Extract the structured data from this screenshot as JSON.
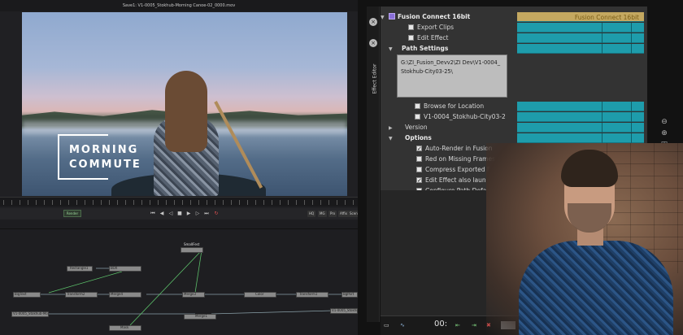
{
  "viewer": {
    "filename": "Save1: V1-0005_Stokhub-Morning Canoe-02_0000.mov",
    "title_line1": "MORNING",
    "title_line2": "COMMUTE"
  },
  "transport": {
    "render_label": "Render",
    "chips": [
      "HQ",
      "MG",
      "Prx",
      "Affix",
      "Scene"
    ]
  },
  "node_editor": {
    "nodes": [
      "SmallFest",
      "Rectangle1",
      "BOX",
      "BigText",
      "Transform2",
      "Merge4",
      "Merge3",
      "Color",
      "Transform1",
      "BgPort",
      "V1-0005_Stokhub-Mo...",
      "Merge1",
      "Mask",
      "V1-0005_Stokhub-Mo..."
    ]
  },
  "effect_editor": {
    "side_label": "Effect Editor",
    "header_title": "Fusion Connect 16bit",
    "header_keyframe_label": "Fusion Connect 16bit",
    "rows": {
      "export_clips": "Export Clips",
      "edit_effect": "Edit Effect",
      "path_settings": "Path Settings",
      "browse": "Browse for Location",
      "clip_name": "V1-0004_Stokhub-City03-2",
      "version": "Version",
      "options": "Options",
      "auto_render": "Auto-Render in Fusion",
      "red_missing": "Red on Missing Frames",
      "compress": "Compress Exported Frame",
      "edit_launches": "Edit Effect also launches F",
      "configure": "Configure Path Defaults"
    },
    "path_value": "G:\\ZI_Fusion_Devv2\\ZI Dev\\V1-0004_Stokhub-City03-25\\",
    "timecode": "00:"
  },
  "right_tools": [
    "zoom-out-icon",
    "zoom-in-icon",
    "fit-icon",
    "play-icon",
    "hq-label"
  ],
  "right_tools_hq": "HQ",
  "colors": {
    "keyframe_teal": "#1e9cab",
    "keyframe_gold": "#c4a860",
    "panel_gray": "#333333"
  }
}
